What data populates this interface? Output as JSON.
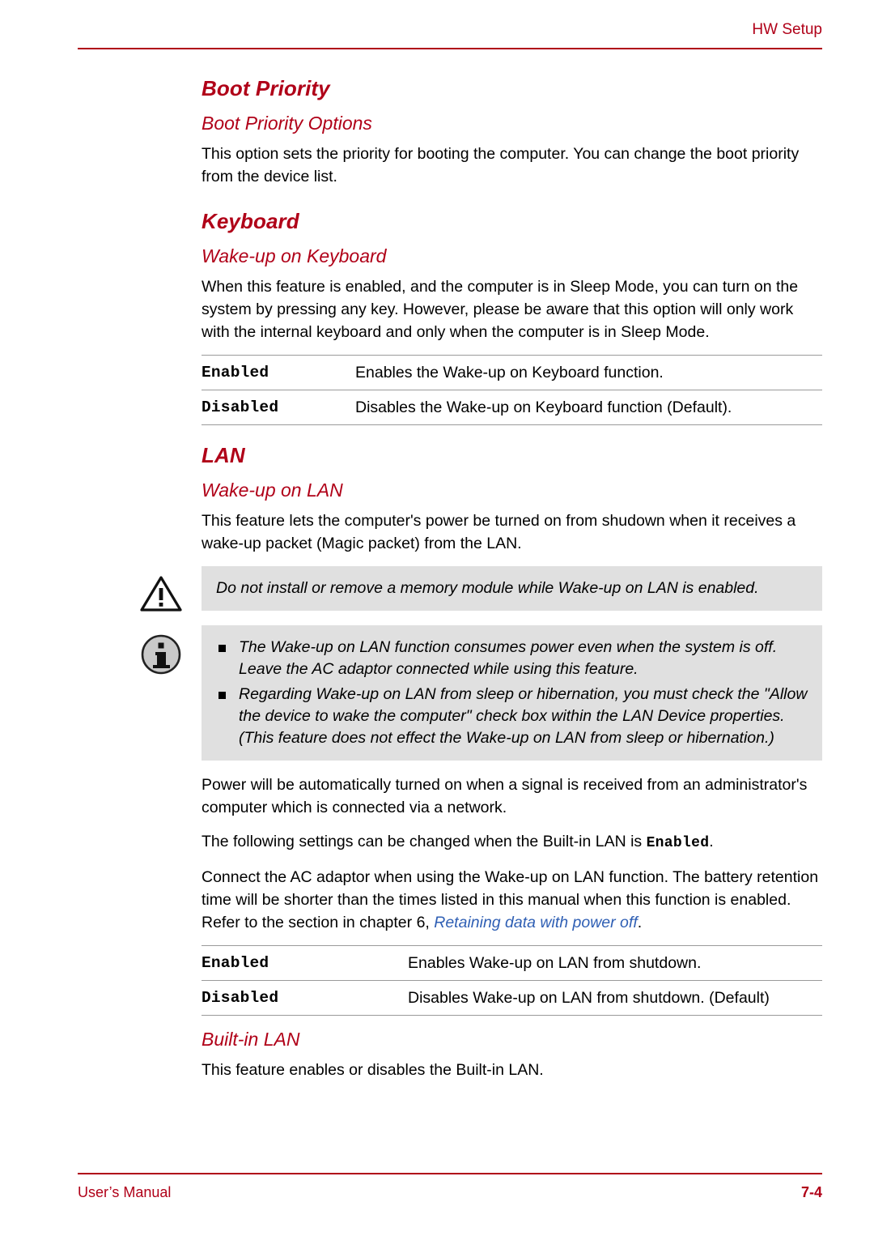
{
  "header": {
    "title": "HW Setup"
  },
  "footer": {
    "left": "User’s Manual",
    "right": "7-4"
  },
  "sections": {
    "boot_priority": {
      "heading": "Boot Priority",
      "subheading": "Boot Priority Options",
      "paragraph": "This option sets the priority for booting the computer. You can change the boot priority from the device list."
    },
    "keyboard": {
      "heading": "Keyboard",
      "subheading": "Wake-up on Keyboard",
      "paragraph": "When this feature is enabled, and the computer is in Sleep Mode, you can turn on the system by pressing any key. However, please be aware that this option will only work with the internal keyboard and only when the computer is in Sleep Mode.",
      "table": [
        {
          "term": "Enabled",
          "desc": "Enables the Wake-up on Keyboard function."
        },
        {
          "term": "Disabled",
          "desc": "Disables the Wake-up on Keyboard function (Default)."
        }
      ]
    },
    "lan": {
      "heading": "LAN",
      "subheading": "Wake-up on LAN",
      "paragraph1": "This feature lets the computer's power be turned on from shudown when it receives a wake-up packet (Magic packet) from the LAN.",
      "warning": {
        "icon": "warning-triangle-icon",
        "text": "Do not install or remove a memory module while Wake-up on LAN is enabled."
      },
      "note": {
        "icon": "info-circle-icon",
        "bullets": [
          "The Wake-up on LAN function consumes power even when the system is off. Leave the AC adaptor connected while using this feature.",
          "Regarding Wake-up on LAN from sleep or hibernation, you must check the \"Allow the device to wake the computer\" check box within the LAN Device properties. (This feature does not effect the Wake-up on LAN from sleep or hibernation.)"
        ]
      },
      "paragraph2": "Power will be automatically turned on when a signal is received from an administrator's computer which is connected via a network.",
      "paragraph3_pre": "The following settings can be changed when the Built-in LAN is ",
      "paragraph3_mono": "Enabled",
      "paragraph3_post": ".",
      "paragraph4_pre": "Connect the AC adaptor when using the Wake-up on LAN function. The battery retention time will be shorter than the times listed in this manual when this function is enabled. Refer to the section in chapter 6, ",
      "paragraph4_link": "Retaining data with power off",
      "paragraph4_post": ".",
      "table": [
        {
          "term": "Enabled",
          "desc": "Enables Wake-up on LAN from shutdown."
        },
        {
          "term": "Disabled",
          "desc": "Disables Wake-up on LAN from shutdown. (Default)"
        }
      ]
    },
    "builtin_lan": {
      "subheading": "Built-in LAN",
      "paragraph": "This feature enables or disables the Built-in LAN."
    }
  },
  "colors": {
    "accent": "#b00018",
    "link": "#2f5fb4",
    "callout_bg": "#e0e0e0"
  }
}
